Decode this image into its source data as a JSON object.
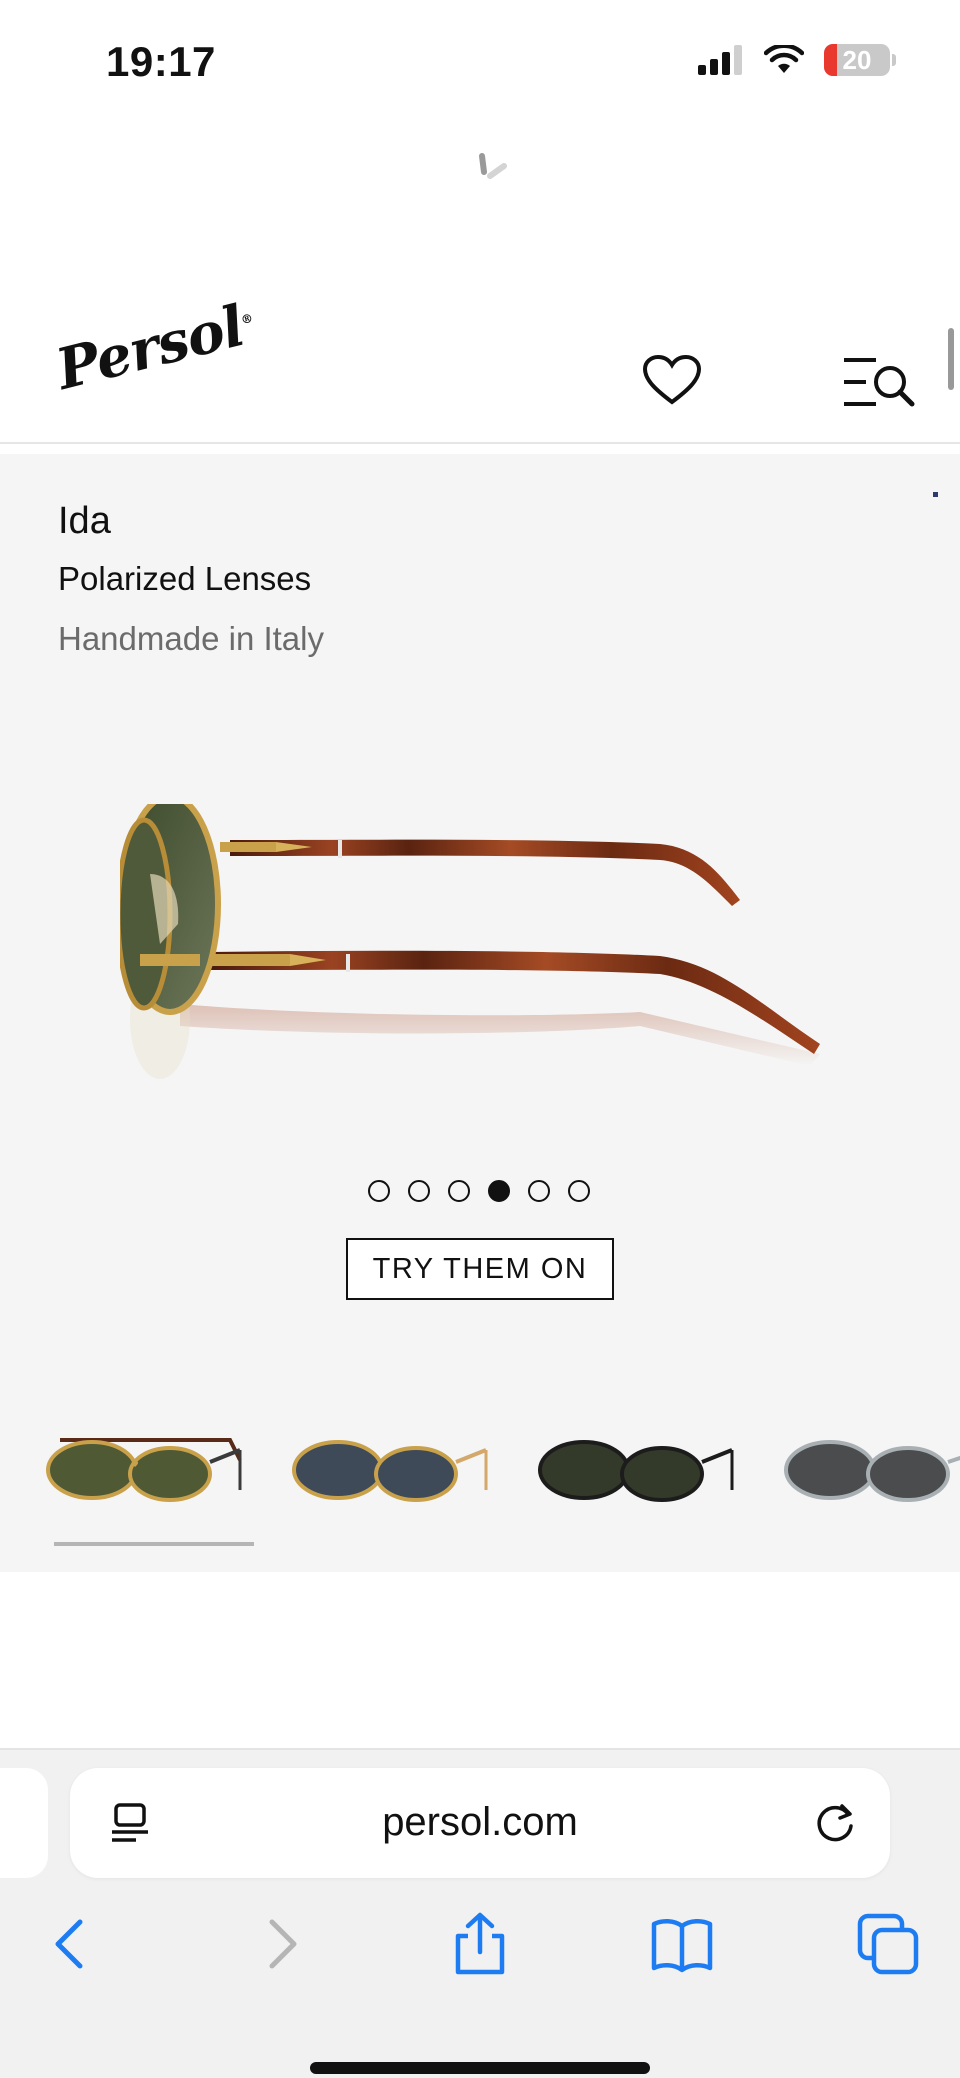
{
  "status_bar": {
    "time": "19:17",
    "battery_level": "20",
    "icons": [
      "cellular-signal-icon",
      "wifi-icon",
      "battery-icon"
    ]
  },
  "header": {
    "logo": "Persol",
    "icons": [
      "heart-icon",
      "menu-search-icon"
    ]
  },
  "product": {
    "name": "Ida",
    "subtitle": "Polarized Lenses",
    "origin": "Handmade in Italy",
    "carousel": {
      "count": 6,
      "active_index": 3
    },
    "try_on_label": "TRY THEM ON",
    "variants": [
      {
        "frame": "gold",
        "lens": "green",
        "selected": true
      },
      {
        "frame": "gold",
        "lens": "blue",
        "selected": false
      },
      {
        "frame": "black",
        "lens": "green",
        "selected": false
      },
      {
        "frame": "silver",
        "lens": "grey",
        "selected": false
      }
    ]
  },
  "browser": {
    "url": "persol.com",
    "toolbar": [
      "back-icon",
      "forward-icon",
      "share-icon",
      "bookmarks-icon",
      "tabs-icon"
    ]
  },
  "colors": {
    "ios_blue": "#1e7cf2",
    "panel_bg": "#f5f5f5",
    "tortoise": "#8a3a1c",
    "gold": "#c9a14a"
  }
}
